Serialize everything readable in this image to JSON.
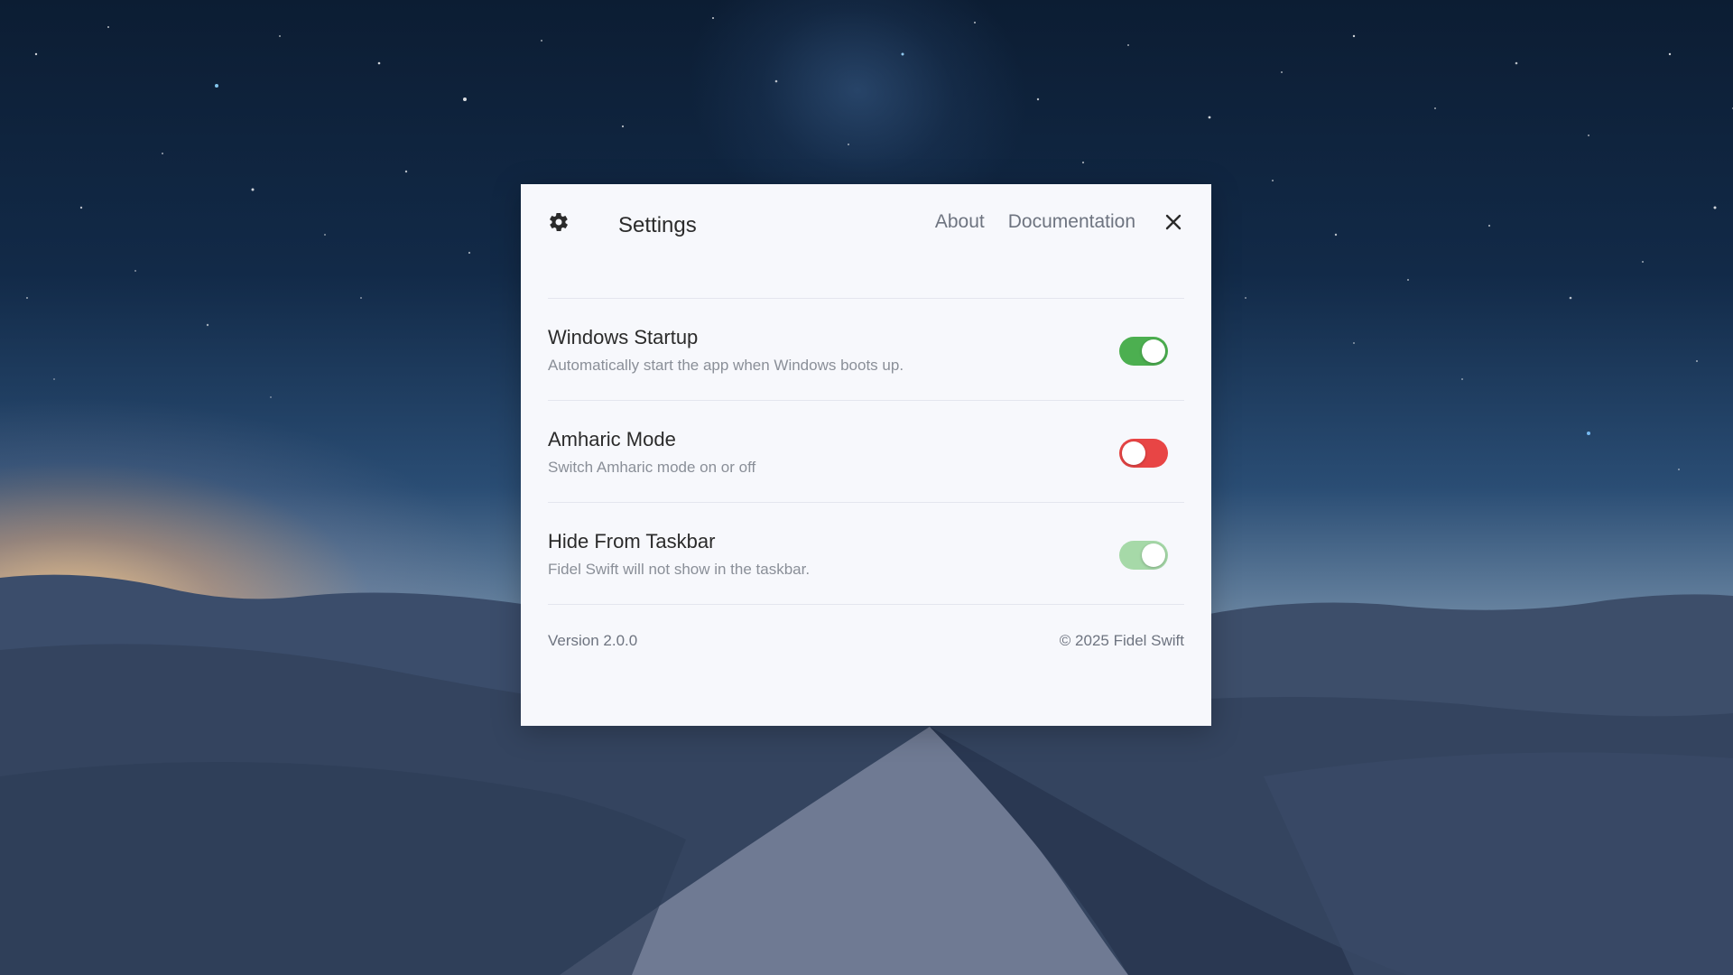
{
  "window": {
    "title": "Settings",
    "icon": "gear-icon",
    "nav_links": [
      "About",
      "Documentation"
    ],
    "close_icon": "close-icon"
  },
  "settings": [
    {
      "title": "Windows Startup",
      "description": "Automatically start the app when Windows boots up.",
      "enabled": true,
      "color": "#4caf50"
    },
    {
      "title": "Amharic Mode",
      "description": "Switch Amharic mode on or off",
      "enabled": false,
      "color": "#e84545"
    },
    {
      "title": "Hide From Taskbar",
      "description": "Fidel Swift will not show in the taskbar.",
      "enabled": true,
      "color": "#a6d9a8"
    }
  ],
  "footer": {
    "version": "Version 2.0.0",
    "copyright": "© 2025 Fidel Swift"
  },
  "colors": {
    "panel_background": "#f7f8fc",
    "text_primary": "#2b2b2b",
    "text_secondary": "#8a8f98",
    "link": "#6e7480"
  }
}
